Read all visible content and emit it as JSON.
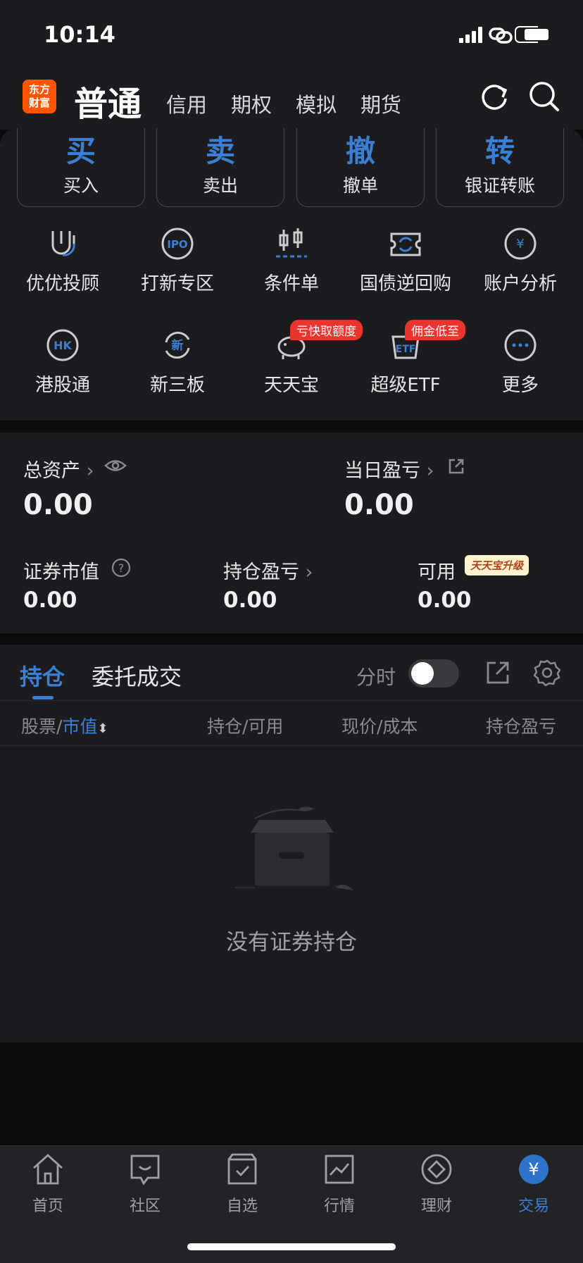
{
  "status": {
    "time": "10:14"
  },
  "header": {
    "logo_top": "东方",
    "logo_bottom": "财富",
    "active_tab": "普通",
    "tabs": [
      "信用",
      "期权",
      "模拟",
      "期货"
    ]
  },
  "actions": [
    {
      "key": "买",
      "label": "买入"
    },
    {
      "key": "卖",
      "label": "卖出"
    },
    {
      "key": "撤",
      "label": "撤单"
    },
    {
      "key": "转",
      "label": "银证转账"
    }
  ],
  "grid_row1": [
    {
      "icon": "youyou-icon",
      "label": "优优投顾"
    },
    {
      "icon": "ipo-icon",
      "label": "打新专区"
    },
    {
      "icon": "candlestick-icon",
      "label": "条件单"
    },
    {
      "icon": "repo-icon",
      "label": "国债逆回购"
    },
    {
      "icon": "account-analysis-icon",
      "label": "账户分析"
    }
  ],
  "grid_row2": [
    {
      "icon": "hk-icon",
      "label": "港股通"
    },
    {
      "icon": "new-board-icon",
      "label": "新三板"
    },
    {
      "icon": "piggy-icon",
      "label": "天天宝",
      "badge": "亏快取额度"
    },
    {
      "icon": "etf-icon",
      "label": "超级ETF",
      "badge": "佣金低至"
    },
    {
      "icon": "more-icon",
      "label": "更多"
    }
  ],
  "assets": {
    "total_label": "总资产",
    "total_value": "0.00",
    "daily_label": "当日盈亏",
    "daily_value": "0.00",
    "market_label": "证券市值",
    "market_value": "0.00",
    "position_pl_label": "持仓盈亏",
    "position_pl_value": "0.00",
    "available_label": "可用",
    "available_value": "0.00",
    "upgrade_badge": "天天宝升级"
  },
  "holdings": {
    "tab_active": "持仓",
    "tab_other": "委托成交",
    "toggle_label": "分时",
    "toggle_on": false,
    "columns": {
      "stock": "股票",
      "market_value": "市值",
      "position": "持仓/可用",
      "price": "现价/成本",
      "pl": "持仓盈亏"
    },
    "empty_text": "没有证券持仓"
  },
  "bottom_nav": [
    {
      "icon": "home-icon",
      "label": "首页"
    },
    {
      "icon": "community-icon",
      "label": "社区"
    },
    {
      "icon": "watchlist-icon",
      "label": "自选"
    },
    {
      "icon": "market-icon",
      "label": "行情"
    },
    {
      "icon": "wealth-icon",
      "label": "理财"
    },
    {
      "icon": "trade-icon",
      "label": "交易",
      "active": true
    }
  ],
  "colors": {
    "accent": "#3a7fd5",
    "badge": "#e8362f",
    "logo": "#ff5500",
    "background": "#1c1c1e"
  }
}
